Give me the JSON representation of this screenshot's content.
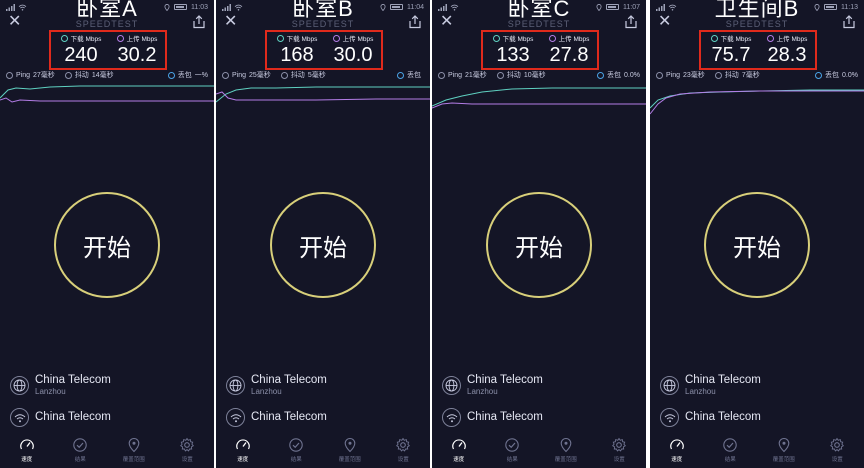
{
  "colors": {
    "background": "#141526",
    "download": "#5fd1c1",
    "upload": "#b37de6",
    "highlight_box": "#e02a1c",
    "go_ring": "#d8cf7a"
  },
  "brand": "SPEEDTEST",
  "labels": {
    "download": "下载 Mbps",
    "upload": "上传 Mbps",
    "ping": "Ping",
    "jitter": "抖动",
    "loss": "丢包",
    "go": "开始"
  },
  "tabs": [
    {
      "label": "速度",
      "icon": "speedometer-icon"
    },
    {
      "label": "结果",
      "icon": "check-circle-icon"
    },
    {
      "label": "覆盖范围",
      "icon": "map-pin-icon"
    },
    {
      "label": "设置",
      "icon": "gear-icon"
    }
  ],
  "screens": [
    {
      "room": "卧室A",
      "time": "11:03",
      "download": "240",
      "upload": "30.2",
      "ping": "27毫秒",
      "jitter": "14毫秒",
      "loss": "一%",
      "provider1_name": "China Telecom",
      "provider1_sub": "Lanzhou",
      "provider2_name": "China Telecom"
    },
    {
      "room": "卧室B",
      "time": "11:04",
      "download": "168",
      "upload": "30.0",
      "ping": "25毫秒",
      "jitter": "5毫秒",
      "loss": "",
      "provider1_name": "China Telecom",
      "provider1_sub": "Lanzhou",
      "provider2_name": "China Telecom"
    },
    {
      "room": "卧室C",
      "time": "11:07",
      "download": "133",
      "upload": "27.8",
      "ping": "21毫秒",
      "jitter": "10毫秒",
      "loss": "0.0%",
      "provider1_name": "China Telecom",
      "provider1_sub": "Lanzhou",
      "provider2_name": "China Telecom"
    },
    {
      "room": "卫生间B",
      "time": "11:13",
      "download": "75.7",
      "upload": "28.3",
      "ping": "23毫秒",
      "jitter": "7毫秒",
      "loss": "0.0%",
      "provider1_name": "China Telecom",
      "provider1_sub": "Lanzhou",
      "provider2_name": "China Telecom"
    }
  ]
}
